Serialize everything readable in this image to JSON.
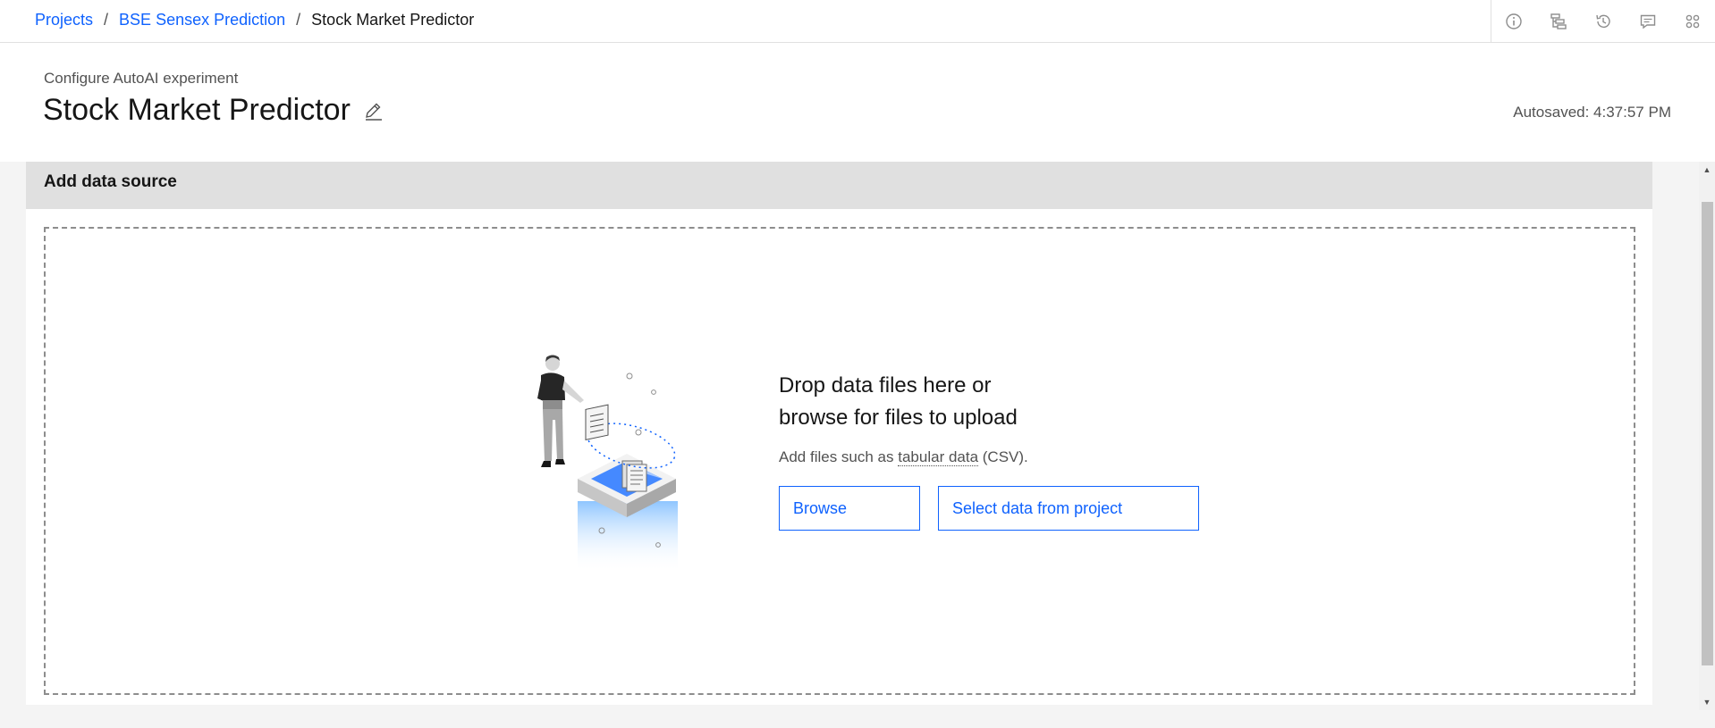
{
  "breadcrumb": {
    "items": [
      "Projects",
      "BSE Sensex Prediction"
    ],
    "separator": "/",
    "current": "Stock Market Predictor"
  },
  "top_actions": [
    "info-icon",
    "hierarchy-icon",
    "history-icon",
    "chat-icon",
    "apps-icon"
  ],
  "header": {
    "subtitle": "Configure AutoAI experiment",
    "title": "Stock Market Predictor",
    "autosave": "Autosaved: 4:37:57 PM"
  },
  "panel": {
    "heading": "Add data source",
    "drop_title_line1": "Drop data files here or",
    "drop_title_line2": "browse for files to upload",
    "desc_prefix": "Add files such as ",
    "desc_term": "tabular data",
    "desc_suffix": " (CSV).",
    "browse_label": "Browse",
    "select_label": "Select data from project"
  },
  "colors": {
    "link": "#0f62fe",
    "panel_head_bg": "#e0e0e0",
    "page_bg": "#f4f4f4"
  }
}
